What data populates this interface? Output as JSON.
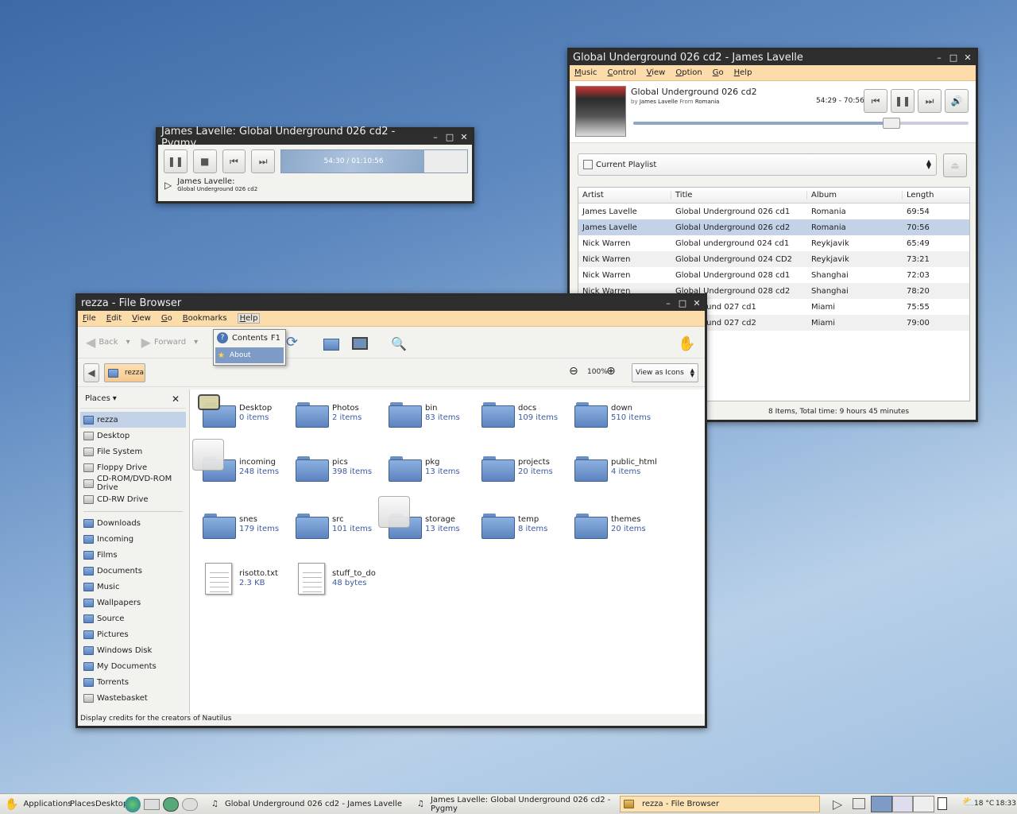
{
  "pygmy": {
    "title": "James Lavelle: Global Underground 026 cd2 - Pygmy",
    "time": "54:30 / 01:10:56",
    "progress": 0.77,
    "artist": "James Lavelle:",
    "album": "Global Underground 026 cd2"
  },
  "player": {
    "title": "Global Underground 026 cd2 - James Lavelle",
    "menu": [
      "Music",
      "Control",
      "View",
      "Option",
      "Go",
      "Help"
    ],
    "song_title": "Global Underground 026 cd2",
    "by_label": "by",
    "artist": "James Lavelle",
    "from_label": "From",
    "album": "Romania",
    "time": "54:29 - 70:56",
    "progress": 0.77,
    "playlist_label": "Current Playlist",
    "columns": [
      "Artist",
      "Title",
      "Album",
      "Length"
    ],
    "rows": [
      [
        "James Lavelle",
        "Global Underground 026 cd1",
        "Romania",
        "69:54"
      ],
      [
        "James Lavelle",
        "Global Underground 026 cd2",
        "Romania",
        "70:56"
      ],
      [
        "Nick Warren",
        "Global underground 024 cd1",
        "Reykjavik",
        "65:49"
      ],
      [
        "Nick Warren",
        "Global Underground 024 CD2",
        "Reykjavik",
        "73:21"
      ],
      [
        "Nick Warren",
        "Global Underground 028 cd1",
        "Shanghai",
        "72:03"
      ],
      [
        "Nick Warren",
        "Global Underground 028 cd2",
        "Shanghai",
        "78:20"
      ],
      [
        "",
        "nderground 027 cd1",
        "Miami",
        "75:55"
      ],
      [
        "",
        "nderground 027 cd2",
        "Miami",
        "79:00"
      ]
    ],
    "status": "8 Items,  Total time: 9 hours 45 minutes"
  },
  "browser": {
    "title": "rezza - File Browser",
    "menu": [
      "File",
      "Edit",
      "View",
      "Go",
      "Bookmarks",
      "Help"
    ],
    "back": "Back",
    "forward": "Forward",
    "crumb": "rezza",
    "zoom": "100%",
    "view_as": "View as Icons",
    "places_label": "Places",
    "places": [
      "rezza",
      "Desktop",
      "File System",
      "Floppy Drive",
      "CD-ROM/DVD-ROM Drive",
      "CD-RW Drive"
    ],
    "bookmarks": [
      "Downloads",
      "Incoming",
      "Films",
      "Documents",
      "Music",
      "Wallpapers",
      "Source",
      "Pictures",
      "Windows Disk",
      "My Documents",
      "Torrents",
      "Wastebasket"
    ],
    "files": [
      {
        "name": "Desktop",
        "info": "0 items"
      },
      {
        "name": "Photos",
        "info": "2 items"
      },
      {
        "name": "bin",
        "info": "83 items"
      },
      {
        "name": "docs",
        "info": "109 items"
      },
      {
        "name": "down",
        "info": "510 items"
      },
      {
        "name": "incoming",
        "info": "248 items"
      },
      {
        "name": "pics",
        "info": "398 items"
      },
      {
        "name": "pkg",
        "info": "13 items"
      },
      {
        "name": "projects",
        "info": "20 items"
      },
      {
        "name": "public_html",
        "info": "4 items"
      },
      {
        "name": "snes",
        "info": "179 items"
      },
      {
        "name": "src",
        "info": "101 items"
      },
      {
        "name": "storage",
        "info": "13 items"
      },
      {
        "name": "temp",
        "info": "8 items"
      },
      {
        "name": "themes",
        "info": "20 items"
      },
      {
        "name": "risotto.txt",
        "info": "2.3 KB"
      },
      {
        "name": "stuff_to_do",
        "info": "48 bytes"
      }
    ],
    "help_menu": {
      "contents": "Contents",
      "contents_key": "F1",
      "about": "About"
    },
    "status": "Display credits for the creators of Nautilus"
  },
  "taskbar": {
    "applications": "Applications",
    "places": "Places",
    "desktop": "Desktop",
    "tasks": [
      "Global Underground 026 cd2 - James Lavelle",
      "James Lavelle: Global Underground 026 cd2 - Pygmy",
      "rezza - File Browser"
    ],
    "weather": "18 °C",
    "clock": "18:33"
  }
}
